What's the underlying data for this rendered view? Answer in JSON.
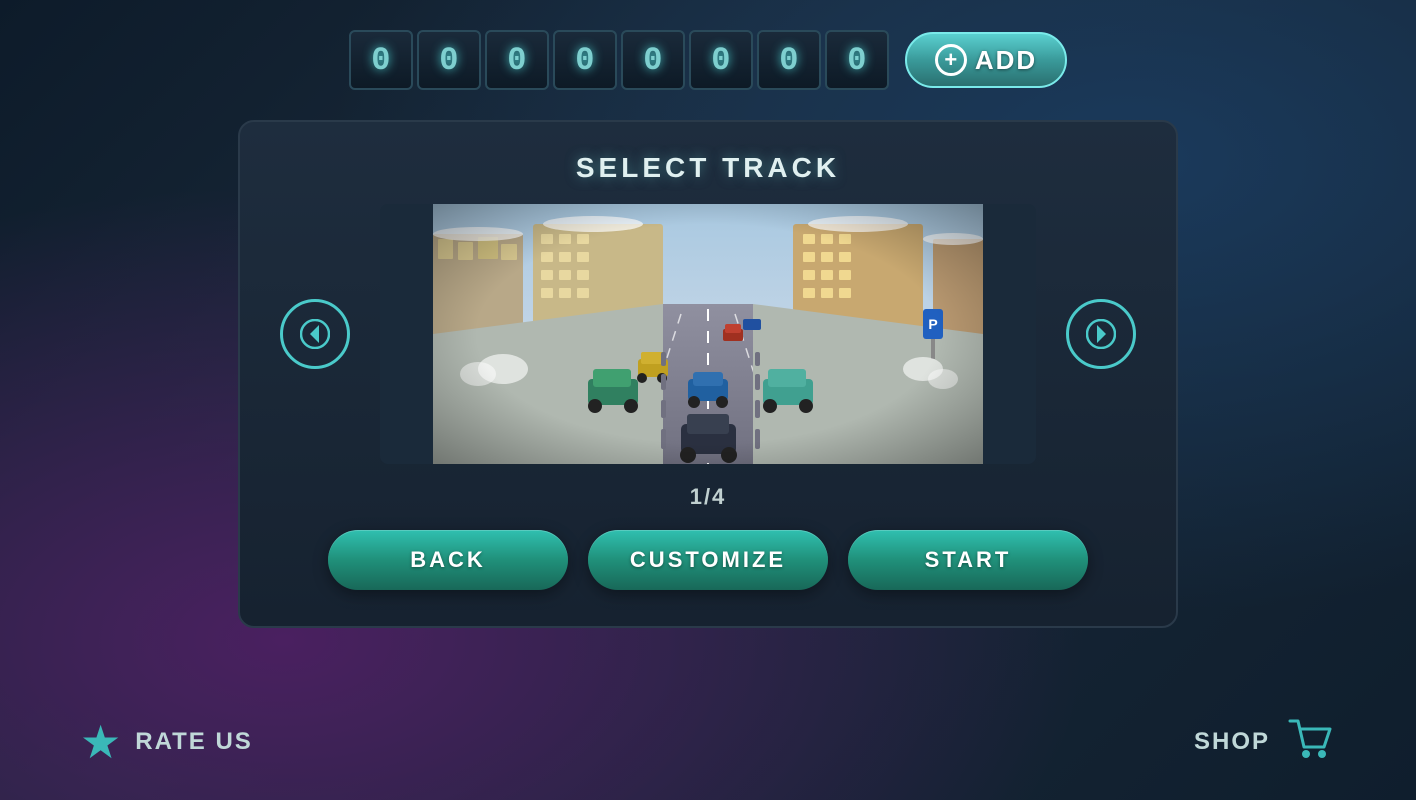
{
  "score": {
    "digits": [
      "0",
      "0",
      "0",
      "0",
      "0",
      "0",
      "0",
      "0"
    ],
    "label": "00000000"
  },
  "add_button": {
    "label": "ADD",
    "icon_symbol": "+"
  },
  "panel": {
    "title": "SELECT TRACK",
    "track_counter": "1/4"
  },
  "buttons": {
    "back": "BACK",
    "customize": "CUSTOMIZE",
    "start": "START"
  },
  "bottom": {
    "rate_us": "RATE US",
    "shop": "SHOP"
  },
  "colors": {
    "teal": "#3ab8b8",
    "button_bg": "#20907a",
    "panel_bg": "#1e2d3e"
  }
}
